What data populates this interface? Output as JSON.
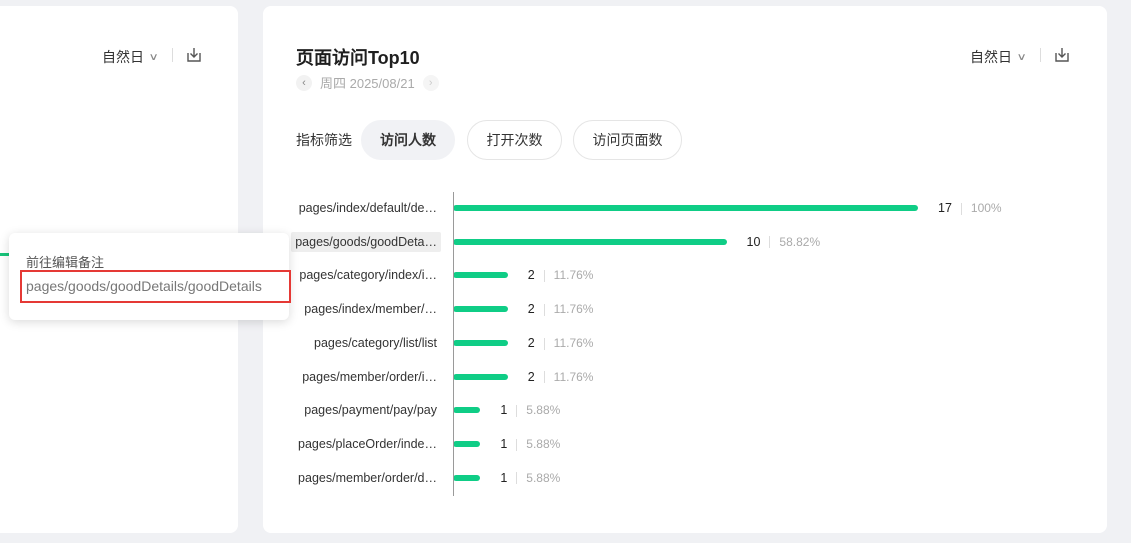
{
  "left_panel": {
    "period": "自然日"
  },
  "header": {
    "title": "页面访问Top10",
    "period": "自然日",
    "date_label": "周四 2025/08/21"
  },
  "filters": {
    "label": "指标筛选",
    "options": [
      "访问人数",
      "打开次数",
      "访问页面数"
    ],
    "selected": "访问人数"
  },
  "tooltip": {
    "action": "前往编辑备注",
    "path": "pages/goods/goodDetails/goodDetails"
  },
  "colors": {
    "bar": "#0fcd86",
    "accent_border": "#e53935"
  },
  "icons": [
    "chevron-down-icon",
    "export-icon",
    "chevron-left-icon",
    "chevron-right-icon"
  ],
  "chart_data": {
    "type": "bar",
    "orientation": "horizontal",
    "categories": [
      "pages/index/default/de…",
      "pages/goods/goodDeta…",
      "pages/category/index/i…",
      "pages/index/member/…",
      "pages/category/list/list",
      "pages/member/order/i…",
      "pages/payment/pay/pay",
      "pages/placeOrder/inde…",
      "pages/member/order/d…"
    ],
    "values": [
      17,
      10,
      2,
      2,
      2,
      2,
      1,
      1,
      1
    ],
    "percent_labels": [
      "100%",
      "58.82%",
      "11.76%",
      "11.76%",
      "11.76%",
      "11.76%",
      "5.88%",
      "5.88%",
      "5.88%"
    ],
    "xlim": [
      0,
      17
    ]
  }
}
